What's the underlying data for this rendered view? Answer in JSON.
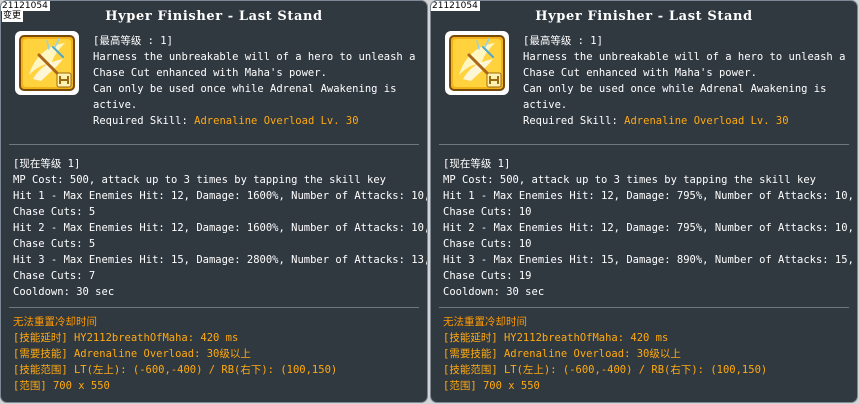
{
  "panels": [
    {
      "skill_id": "21121054",
      "changed_tag": "变更",
      "title": "Hyper Finisher - Last Stand",
      "icon": "hyper-finisher-skill-icon",
      "max_level": "[最高等级 : 1]",
      "description": [
        "Harness the unbreakable will of a hero to unleash a",
        "Chase Cut enhanced with Maha's power.",
        "Can only be used once while Adrenal Awakening is",
        "active."
      ],
      "required_label": "Required Skill: ",
      "required_value": "Adrenaline Overload Lv. 30",
      "current_level": "[现在等级 1]",
      "stats": [
        "MP Cost: 500, attack up to 3 times by tapping the skill key",
        "Hit 1 - Max Enemies Hit: 12, Damage: 1600%, Number of Attacks: 10,",
        "Chase Cuts: 5",
        "Hit 2 - Max Enemies Hit: 12, Damage: 1600%, Number of Attacks: 10,",
        "Chase Cuts: 5",
        "Hit 3 - Max Enemies Hit: 15, Damage: 2800%, Number of Attacks: 13,",
        "Chase Cuts: 7",
        "Cooldown: 30 sec"
      ],
      "info": [
        "无法重置冷却时间",
        "[技能延时] HY2112breathOfMaha: 420 ms",
        "[需要技能] Adrenaline Overload: 30级以上",
        "[技能范围] LT(左上): (-600,-400) / RB(右下): (100,150)",
        "[范围] 700 x 550"
      ]
    },
    {
      "skill_id": "21121054",
      "changed_tag": "",
      "title": "Hyper Finisher - Last Stand",
      "icon": "hyper-finisher-skill-icon",
      "max_level": "[最高等级 : 1]",
      "description": [
        "Harness the unbreakable will of a hero to unleash a",
        "Chase Cut enhanced with Maha's power.",
        "Can only be used once while Adrenal Awakening is",
        "active."
      ],
      "required_label": "Required Skill: ",
      "required_value": "Adrenaline Overload Lv. 30",
      "current_level": "[现在等级 1]",
      "stats": [
        "MP Cost: 500, attack up to 3 times by tapping the skill key",
        "Hit 1 - Max Enemies Hit: 12, Damage: 795%, Number of Attacks: 10,",
        "Chase Cuts: 10",
        "Hit 2 - Max Enemies Hit: 12, Damage: 795%, Number of Attacks: 10,",
        "Chase Cuts: 10",
        "Hit 3 - Max Enemies Hit: 15, Damage: 890%, Number of Attacks: 15,",
        "Chase Cuts: 19",
        "Cooldown: 30 sec"
      ],
      "info": [
        "无法重置冷却时间",
        "[技能延时] HY2112breathOfMaha: 420 ms",
        "[需要技能] Adrenaline Overload: 30级以上",
        "[技能范围] LT(左上): (-600,-400) / RB(右下): (100,150)",
        "[范围] 700 x 550"
      ]
    }
  ],
  "colors": {
    "panel_bg": "#303840",
    "panel_border": "#7d8896",
    "text": "#ffffff",
    "highlight": "#ffaa11"
  }
}
